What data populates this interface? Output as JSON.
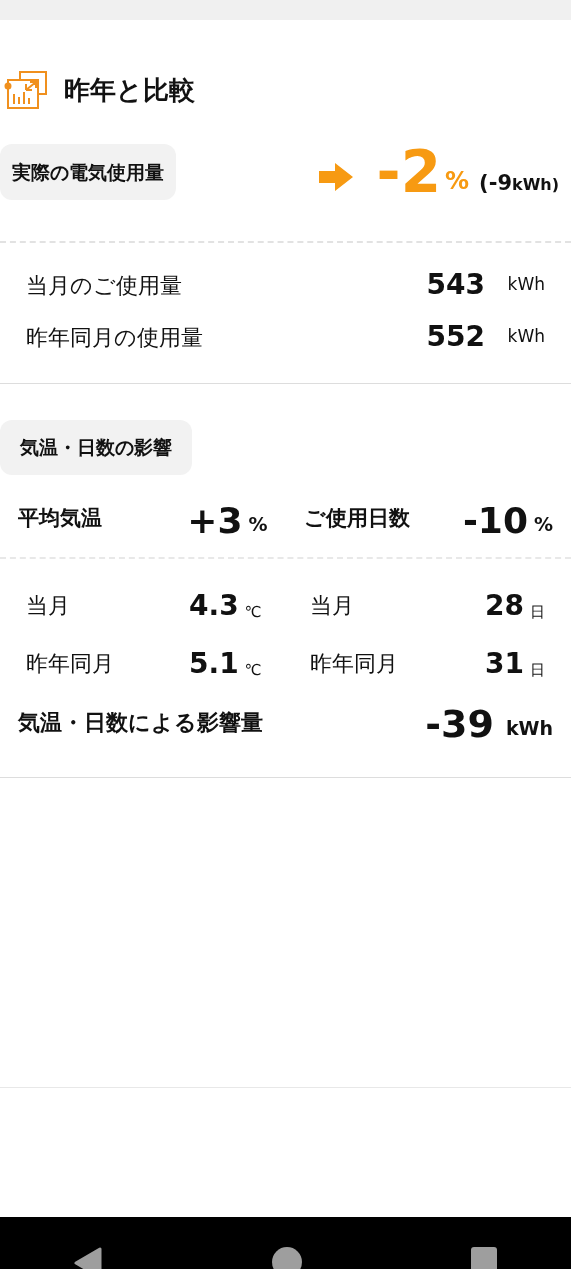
{
  "header": {
    "title": "昨年と比較"
  },
  "actual": {
    "label": "実際の電気使用量",
    "change": "-2",
    "change_unit": "%",
    "detail_value": "(-9",
    "detail_unit": "kWh)"
  },
  "usage": [
    {
      "label": "当月のご使用量",
      "value": "543",
      "unit": "kWh"
    },
    {
      "label": "昨年同月の使用量",
      "value": "552",
      "unit": "kWh"
    }
  ],
  "influence": {
    "label": "気温・日数の影響",
    "factors": [
      {
        "label": "平均気温",
        "value": "+3",
        "unit": "%",
        "rows": [
          {
            "label": "当月",
            "value": "4.3",
            "unit": "℃"
          },
          {
            "label": "昨年同月",
            "value": "5.1",
            "unit": "℃"
          }
        ]
      },
      {
        "label": "ご使用日数",
        "value": "-10",
        "unit": "%",
        "rows": [
          {
            "label": "当月",
            "value": "28",
            "unit": "日"
          },
          {
            "label": "昨年同月",
            "value": "31",
            "unit": "日"
          }
        ]
      }
    ],
    "total": {
      "label": "気温・日数による影響量",
      "value": "-39",
      "unit": "kWh"
    }
  }
}
